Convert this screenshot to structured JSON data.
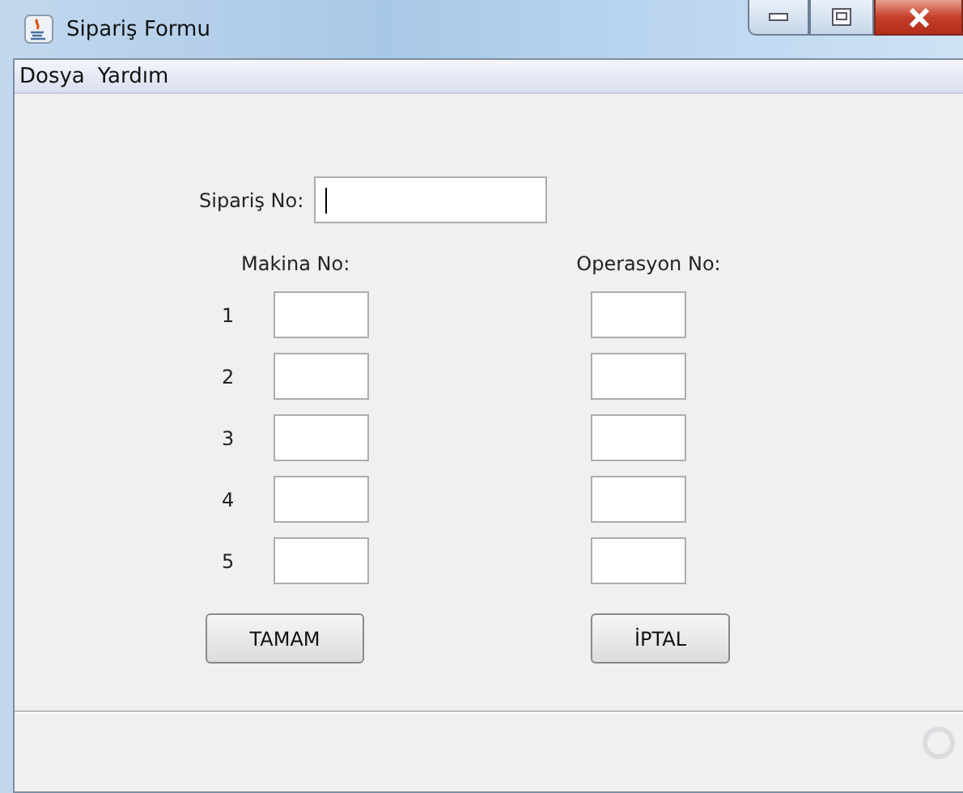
{
  "window": {
    "title": "Sipariş Formu"
  },
  "menu": [
    "Dosya",
    "Yardım"
  ],
  "order": {
    "label": "Sipariş No:",
    "focused": true
  },
  "columns": [
    "Makina No:",
    "Operasyon No:"
  ],
  "rows": [
    "1",
    "2",
    "3",
    "4",
    "5"
  ],
  "buttons": [
    "TAMAM",
    "İPTAL"
  ]
}
